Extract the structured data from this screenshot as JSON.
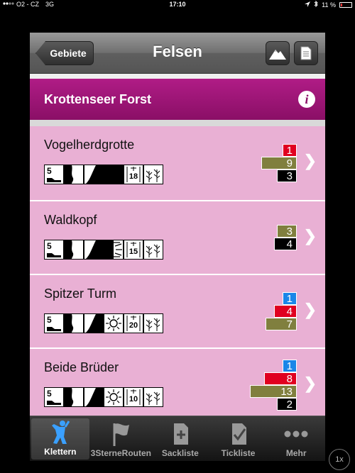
{
  "status": {
    "carrier": "O2 - CZ",
    "network": "3G",
    "time": "17:10",
    "battery": "11 %"
  },
  "nav": {
    "back_label": "Gebiete",
    "title": "Felsen"
  },
  "area": {
    "name": "Krottenseer Forst"
  },
  "colors": {
    "accent": "#9b1475",
    "row_bg": "#e9b0d4",
    "red": "#e00020",
    "olive": "#807f3e",
    "blue": "#1a86e8",
    "black": "#000000"
  },
  "rocks": [
    {
      "name": "Vogelherdgrotte",
      "grade": "5",
      "badge_num": "18",
      "grades": [
        {
          "value": "1",
          "color": "#e00020",
          "width": 20
        },
        {
          "value": "9",
          "color": "#807f3e",
          "width": 50
        },
        {
          "value": "3",
          "color": "#000000",
          "width": 28
        }
      ]
    },
    {
      "name": "Waldkopf",
      "grade": "5",
      "badge_num": "15",
      "grades": [
        {
          "value": "3",
          "color": "#807f3e",
          "width": 28
        },
        {
          "value": "4",
          "color": "#000000",
          "width": 32
        }
      ]
    },
    {
      "name": "Spitzer Turm",
      "grade": "5",
      "badge_num": "20",
      "grades": [
        {
          "value": "1",
          "color": "#1a86e8",
          "width": 20
        },
        {
          "value": "4",
          "color": "#e00020",
          "width": 32
        },
        {
          "value": "7",
          "color": "#807f3e",
          "width": 44
        }
      ]
    },
    {
      "name": "Beide Brüder",
      "grade": "5",
      "badge_num": "10",
      "grades": [
        {
          "value": "1",
          "color": "#1a86e8",
          "width": 20
        },
        {
          "value": "8",
          "color": "#e00020",
          "width": 46
        },
        {
          "value": "13",
          "color": "#807f3e",
          "width": 66
        },
        {
          "value": "2",
          "color": "#000000",
          "width": 28
        }
      ]
    }
  ],
  "tabs": [
    {
      "label": "Klettern",
      "icon": "climber-icon",
      "active": true
    },
    {
      "label": "3SterneRouten",
      "icon": "flag-icon",
      "active": false
    },
    {
      "label": "Sackliste",
      "icon": "add-document-icon",
      "active": false
    },
    {
      "label": "Tickliste",
      "icon": "check-document-icon",
      "active": false
    },
    {
      "label": "Mehr",
      "icon": "more-dots-icon",
      "active": false
    }
  ],
  "zoom": {
    "label": "1x"
  }
}
